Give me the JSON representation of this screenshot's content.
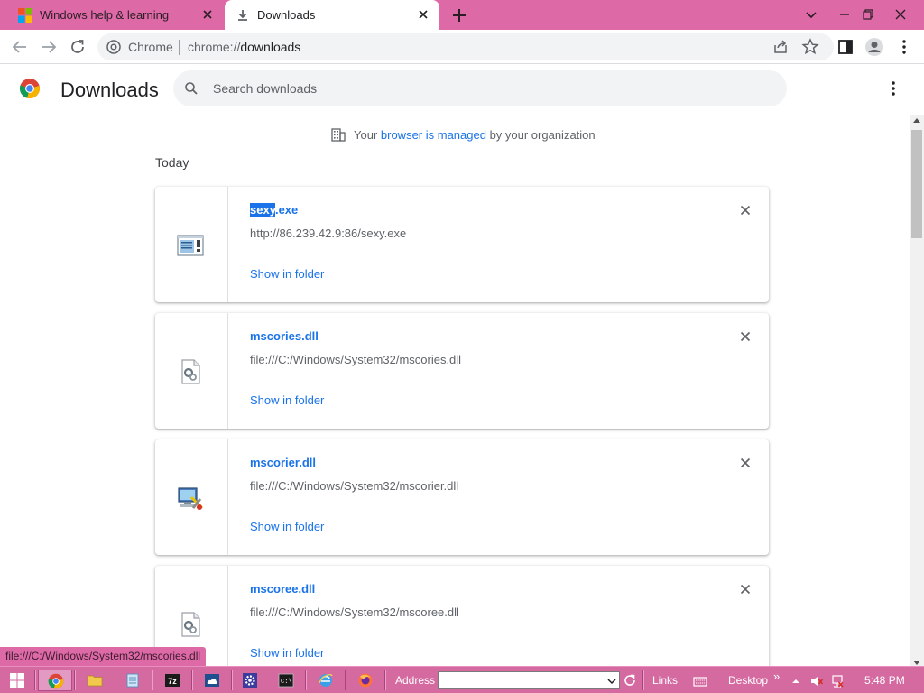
{
  "tabs": [
    {
      "title": "Windows help & learning",
      "active": false
    },
    {
      "title": "Downloads",
      "active": true
    }
  ],
  "toolbar": {
    "site_name": "Chrome",
    "url_scheme": "chrome://",
    "url_path": "downloads"
  },
  "page": {
    "title": "Downloads",
    "search_placeholder": "Search downloads",
    "managed_prefix": "Your ",
    "managed_link": "browser is managed",
    "managed_suffix": " by your organization",
    "section_label": "Today"
  },
  "downloads": [
    {
      "name_selected": "sexy",
      "name_rest": ".exe",
      "url": "http://86.239.42.9:86/sexy.exe",
      "action": "Show in folder",
      "icon": "exe-window-icon"
    },
    {
      "name": "mscories.dll",
      "url": "file:///C:/Windows/System32/mscories.dll",
      "action": "Show in folder",
      "icon": "dll-gear-icon"
    },
    {
      "name": "mscorier.dll",
      "url": "file:///C:/Windows/System32/mscorier.dll",
      "action": "Show in folder",
      "icon": "computer-tools-icon"
    },
    {
      "name": "mscoree.dll",
      "url": "file:///C:/Windows/System32/mscoree.dll",
      "action": "Show in folder",
      "icon": "dll-gear-icon"
    }
  ],
  "status_bubble": "file:///C:/Windows/System32/mscories.dll",
  "taskbar": {
    "address_label": "Address",
    "address_value": "",
    "links_label": "Links",
    "desktop_label": "Desktop",
    "chevron": "»",
    "clock": "5:48 PM"
  },
  "colors": {
    "tabstrip": "#dd6aa7",
    "taskbar": "#d46aa0",
    "link_blue": "#1a73e8"
  }
}
